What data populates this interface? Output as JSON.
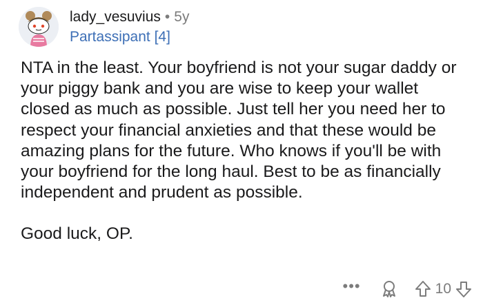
{
  "comment": {
    "username": "lady_vesuvius",
    "separator": "•",
    "age": "5y",
    "flair": "Partassipant [4]",
    "paragraphs": [
      "NTA in the least. Your boyfriend is not your sugar daddy or your piggy bank and you are wise to keep your wallet closed as much as possible. Just tell her you need her to respect your financial anxieties and that these would be amazing plans for the future. Who knows if you'll be with your boyfriend for the long haul. Best to be as financially independent and prudent as possible.",
      "Good luck, OP."
    ],
    "actions": {
      "more_label": "•••",
      "score": "10",
      "award_icon": "award-icon",
      "upvote_icon": "upvote-arrow-icon",
      "downvote_icon": "downvote-arrow-icon"
    }
  },
  "colors": {
    "text": "#1a1a1b",
    "meta_gray": "#7c7c7c",
    "flair_blue": "#3d6fb6"
  }
}
